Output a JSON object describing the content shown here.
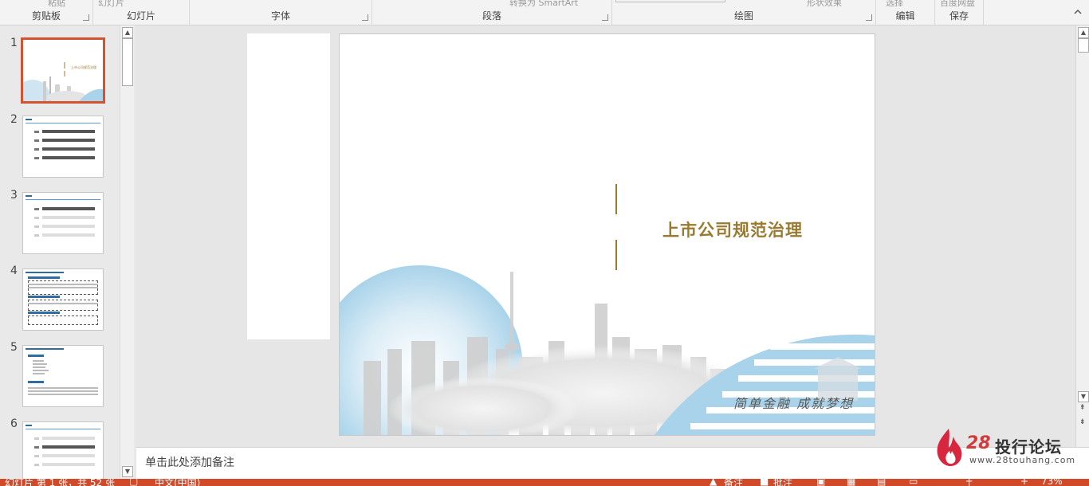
{
  "ribbon": {
    "groups": [
      {
        "label": "剪贴板",
        "cut": "粘贴"
      },
      {
        "label": "幻灯片",
        "cut": "幻灯片"
      },
      {
        "label": "字体",
        "cut": ""
      },
      {
        "label": "段落",
        "cut": "转换为 SmartArt"
      },
      {
        "label": "绘图",
        "cut": "形状效果"
      },
      {
        "label": "编辑",
        "cut": "选择"
      },
      {
        "label": "保存",
        "cut": "百度网盘"
      }
    ]
  },
  "thumbnails": {
    "numbers": [
      "1",
      "2",
      "3",
      "4",
      "5",
      "6"
    ],
    "slide1_title": "上市公司规范治理"
  },
  "slide": {
    "title": "上市公司规范治理",
    "slogan": "简单金融  成就梦想",
    "accent_color": "#9a7a30"
  },
  "notes": {
    "placeholder": "单击此处添加备注"
  },
  "watermark": {
    "number": "28",
    "name": "投行论坛",
    "url": "www.28touhang.com"
  },
  "status": {
    "slide_info": "幻灯片 第 1 张，共 52 张",
    "language": "中文(中国)",
    "notes": "备注",
    "comments": "批注",
    "zoom": "73%"
  },
  "colors": {
    "status_bar": "#d04a2a",
    "selection": "#d35230"
  }
}
